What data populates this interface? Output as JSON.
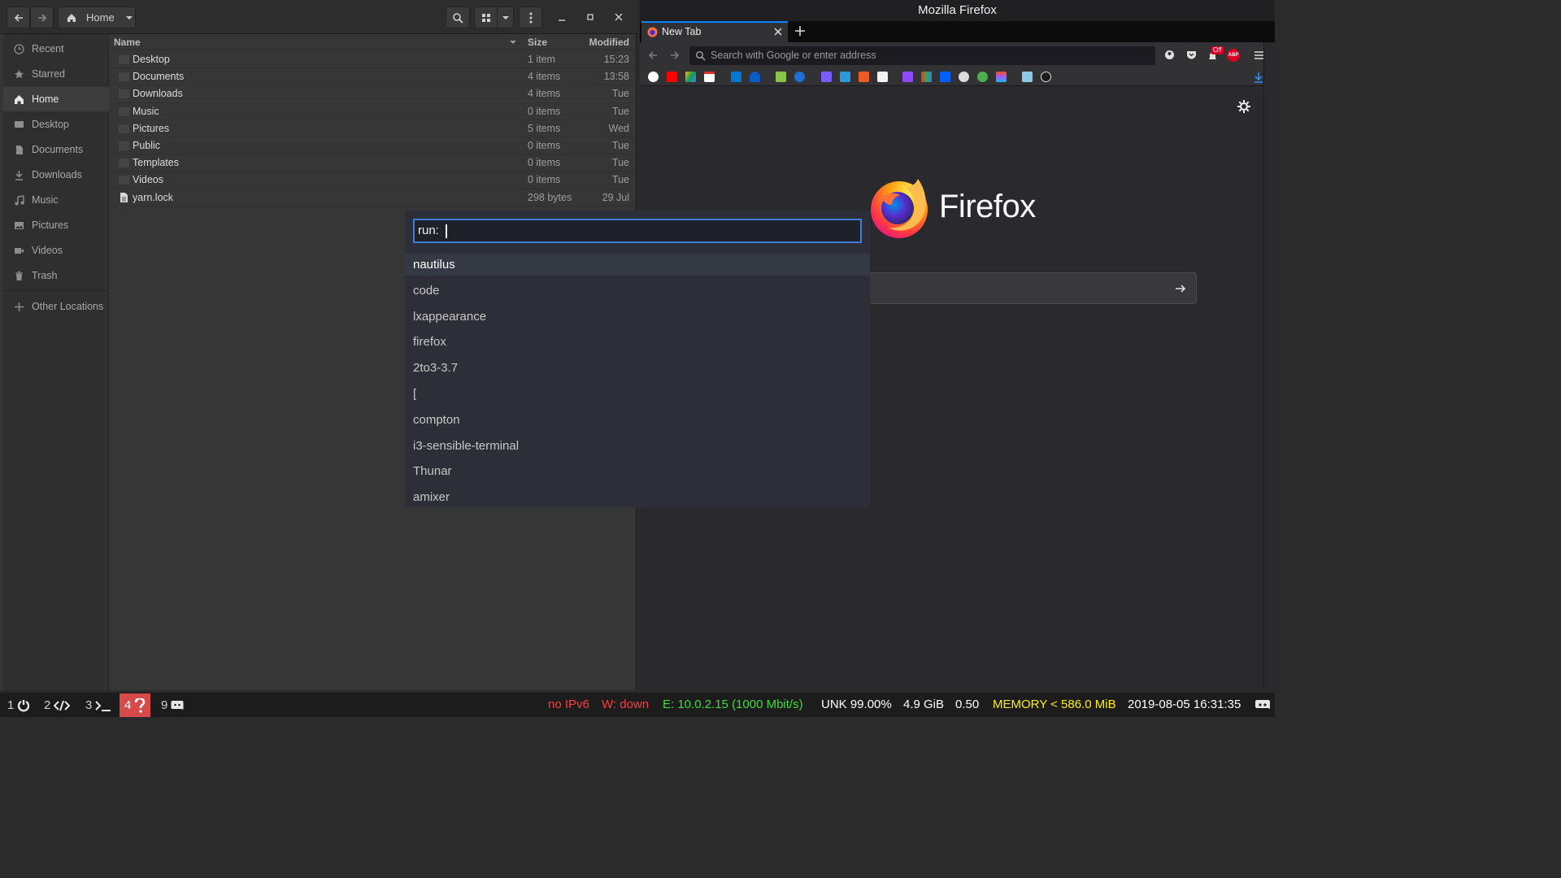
{
  "nautilus": {
    "path_label": "Home",
    "sidebar": [
      {
        "label": "Recent",
        "icon": "clock-icon"
      },
      {
        "label": "Starred",
        "icon": "star-icon"
      },
      {
        "label": "Home",
        "icon": "home-icon",
        "active": true
      },
      {
        "label": "Desktop",
        "icon": "desktop-icon"
      },
      {
        "label": "Documents",
        "icon": "document-icon"
      },
      {
        "label": "Downloads",
        "icon": "download-icon"
      },
      {
        "label": "Music",
        "icon": "music-icon"
      },
      {
        "label": "Pictures",
        "icon": "picture-icon"
      },
      {
        "label": "Videos",
        "icon": "video-icon"
      },
      {
        "label": "Trash",
        "icon": "trash-icon"
      },
      {
        "label": "Other Locations",
        "icon": "plus-icon"
      }
    ],
    "columns": {
      "name": "Name",
      "size": "Size",
      "modified": "Modified"
    },
    "files": [
      {
        "name": "Desktop",
        "size": "1 item",
        "modified": "15:23"
      },
      {
        "name": "Documents",
        "size": "4 items",
        "modified": "13:58"
      },
      {
        "name": "Downloads",
        "size": "4 items",
        "modified": "Tue"
      },
      {
        "name": "Music",
        "size": "0 items",
        "modified": "Tue"
      },
      {
        "name": "Pictures",
        "size": "5 items",
        "modified": "Wed"
      },
      {
        "name": "Public",
        "size": "0 items",
        "modified": "Tue"
      },
      {
        "name": "Templates",
        "size": "0 items",
        "modified": "Tue"
      },
      {
        "name": "Videos",
        "size": "0 items",
        "modified": "Tue"
      },
      {
        "name": "yarn.lock",
        "size": "298 bytes",
        "modified": "29 Jul"
      }
    ]
  },
  "firefox": {
    "window_title": "Mozilla Firefox",
    "tab_title": "New Tab",
    "url_placeholder": "Search with Google or enter address",
    "brand": "Firefox",
    "addon_badge": "Off",
    "addon_abp": "ABP"
  },
  "rofi": {
    "prompt": "run:",
    "items": [
      "nautilus",
      "code",
      "lxappearance",
      "firefox",
      "2to3-3.7",
      "[",
      "compton",
      "i3-sensible-terminal",
      "Thunar",
      "amixer"
    ]
  },
  "bar": {
    "workspaces": [
      {
        "num": "1",
        "icon": "power-icon"
      },
      {
        "num": "2",
        "icon": "code-icon"
      },
      {
        "num": "3",
        "icon": "terminal-icon"
      },
      {
        "num": "4",
        "icon": "question-icon",
        "urgent": true
      },
      {
        "num": "9",
        "icon": "discord-icon"
      }
    ],
    "ipv6": "no IPv6",
    "wifi": "W: down",
    "ethernet": "E: 10.0.2.15 (1000 Mbit/s)",
    "battery": "UNK 99.00%",
    "disk": "4.9 GiB",
    "load": "0.50",
    "memory": "MEMORY < 586.0 MiB",
    "datetime": "2019-08-05 16:31:35",
    "colors": {
      "red": "#ff3b3b",
      "green": "#3ddc3d",
      "yellow": "#ffee00",
      "white": "#ffffff"
    }
  }
}
